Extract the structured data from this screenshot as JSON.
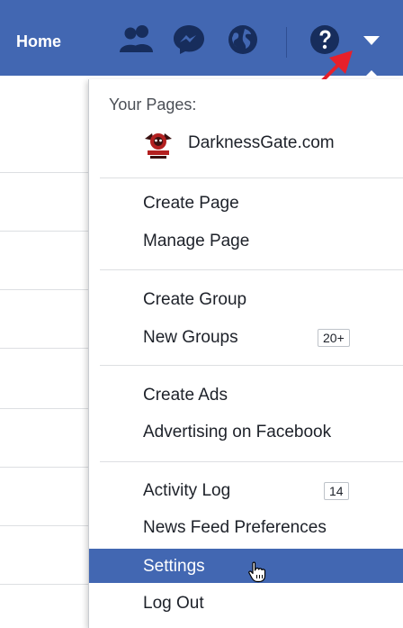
{
  "topbar": {
    "home_label": "Home",
    "icons": [
      "friends-icon",
      "messenger-icon",
      "globe-icon",
      "help-icon",
      "account-menu-caret-icon"
    ],
    "color": "#4267b2"
  },
  "menu": {
    "your_pages_header": "Your Pages:",
    "page_name": "DarknessGate.com",
    "items": {
      "create_page": "Create Page",
      "manage_page": "Manage Page",
      "create_group": "Create Group",
      "new_groups": "New Groups",
      "new_groups_count": "20+",
      "create_ads": "Create Ads",
      "advertising": "Advertising on Facebook",
      "activity_log": "Activity Log",
      "activity_log_count": "14",
      "news_feed_prefs": "News Feed Preferences",
      "settings": "Settings",
      "log_out": "Log Out"
    },
    "highlight_color": "#4267b2"
  },
  "annotation": {
    "arrow_color": "#e8202a"
  }
}
